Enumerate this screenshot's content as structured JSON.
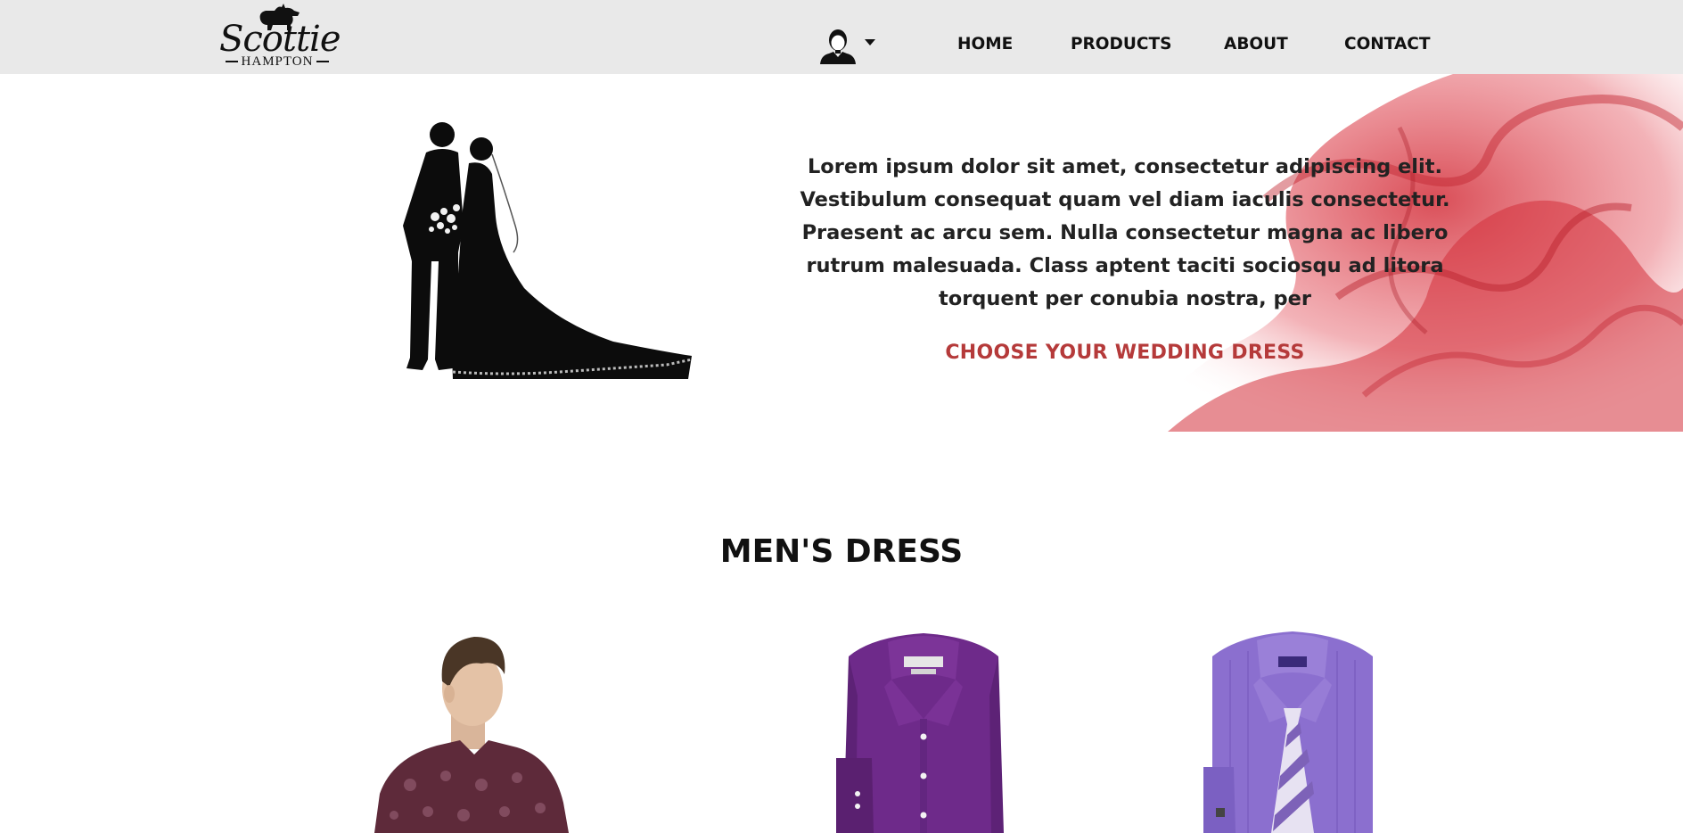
{
  "header": {
    "logo": {
      "script": "Scottie",
      "sub": "HAMPTON"
    },
    "user_menu": {
      "icon": "user-avatar-icon",
      "caret_icon": "caret-down-icon"
    },
    "nav": [
      {
        "label": "HOME"
      },
      {
        "label": "PRODUCTS"
      },
      {
        "label": "ABOUT"
      },
      {
        "label": "CONTACT"
      }
    ]
  },
  "hero": {
    "image_icon": "bride-groom-silhouette",
    "background_icon": "red-smoke",
    "text": "Lorem ipsum dolor sit amet, consectetur adipiscing elit. Vestibulum consequat quam vel diam iaculis consectetur. Praesent ac arcu sem. Nulla consectetur magna ac libero rutrum malesuada. Class aptent taciti sociosqu ad litora torquent per conubia nostra, per",
    "cta": "CHOOSE YOUR WEDDING DRESS"
  },
  "mens_section": {
    "title": "MEN'S DRESS",
    "products": [
      {
        "image": "man-in-floral-shirt"
      },
      {
        "image": "purple-dress-shirt"
      },
      {
        "image": "lavender-shirt-with-tie"
      }
    ]
  },
  "colors": {
    "header_bg": "#e9e9e9",
    "cta": "#b53a3a",
    "smoke": "#d32f3a"
  }
}
